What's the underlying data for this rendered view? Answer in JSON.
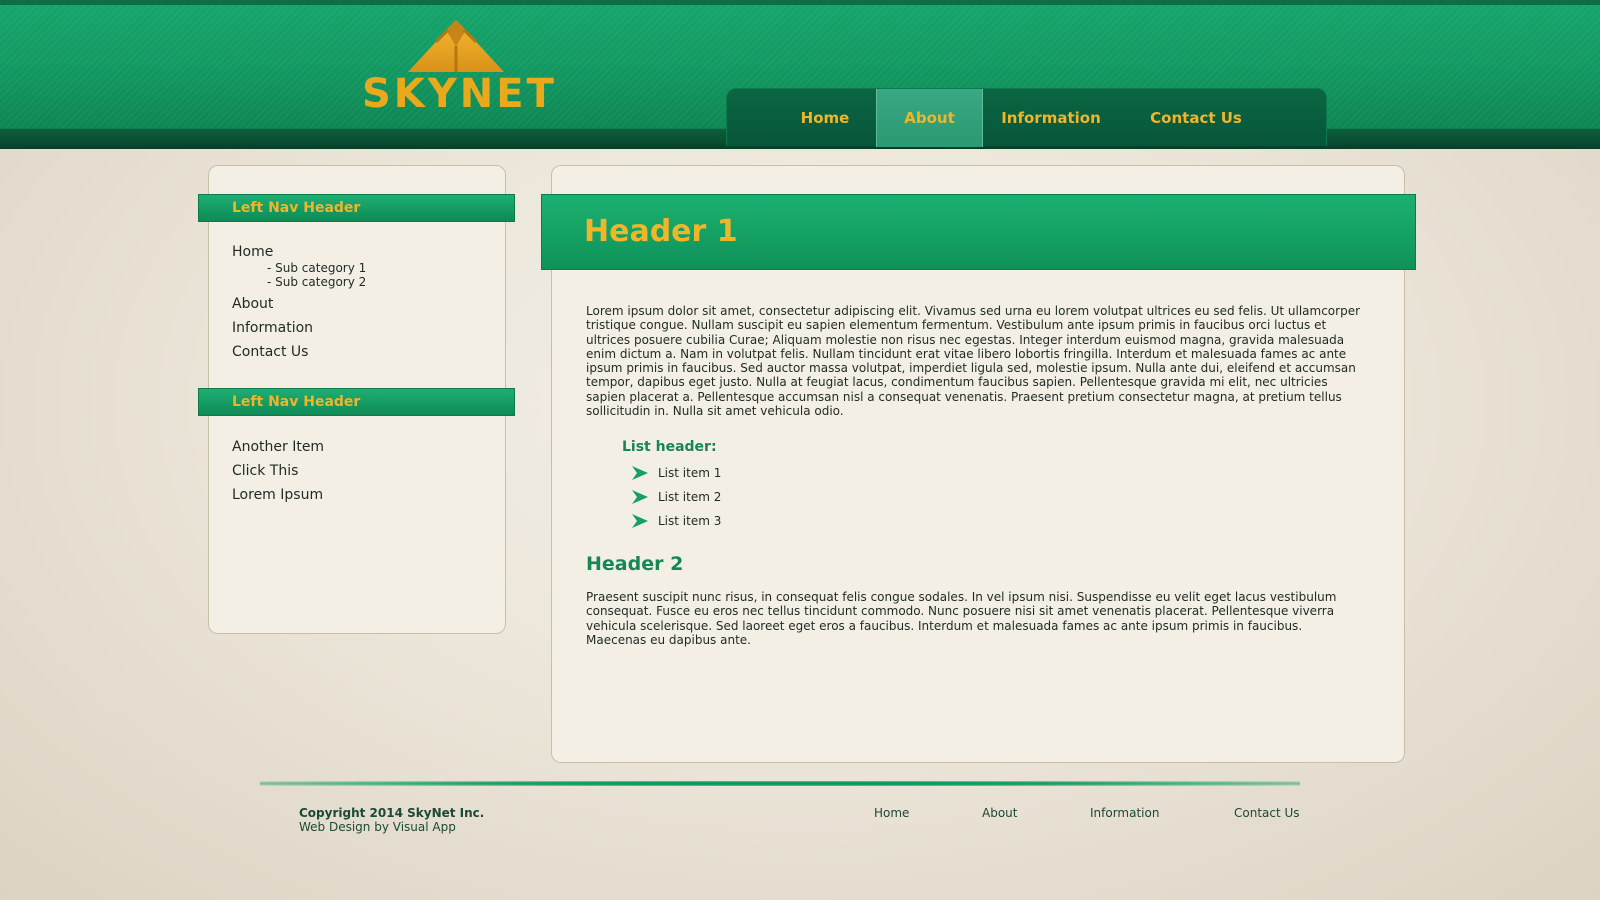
{
  "brand": {
    "name": "SKYNET",
    "colors": {
      "primary_green": "#149b63",
      "gold": "#f0b52a",
      "background": "#ece6da"
    }
  },
  "topnav": {
    "items": [
      {
        "label": "Home",
        "active": false
      },
      {
        "label": "About",
        "active": true
      },
      {
        "label": "Information",
        "active": false
      },
      {
        "label": "Contact Us",
        "active": false
      }
    ]
  },
  "sidebar": {
    "sections": [
      {
        "header": "Left Nav Header",
        "items": [
          {
            "label": "Home",
            "sub": [
              "- Sub category 1",
              "- Sub category 2"
            ]
          },
          {
            "label": "About"
          },
          {
            "label": "Information"
          },
          {
            "label": "Contact Us"
          }
        ]
      },
      {
        "header": "Left Nav Header",
        "items": [
          {
            "label": "Another Item"
          },
          {
            "label": "Click This"
          },
          {
            "label": "Lorem Ipsum"
          }
        ]
      }
    ]
  },
  "main": {
    "title": "Header 1",
    "paragraph1": "Lorem ipsum dolor sit amet, consectetur adipiscing elit. Vivamus sed urna eu lorem volutpat ultrices eu sed felis. Ut ullamcorper tristique congue. Nullam suscipit eu sapien elementum fermentum. Vestibulum ante ipsum primis in faucibus orci luctus et ultrices posuere cubilia Curae; Aliquam molestie non risus nec egestas. Integer interdum euismod magna, gravida malesuada enim dictum a. Nam in volutpat felis. Nullam tincidunt erat vitae libero lobortis fringilla. Interdum et malesuada fames ac ante ipsum primis in faucibus. Sed auctor massa volutpat, imperdiet ligula sed, molestie ipsum. Nulla ante dui, eleifend et accumsan tempor, dapibus eget justo. Nulla at feugiat lacus, condimentum faucibus sapien. Pellentesque gravida mi elit, nec ultricies sapien placerat a. Pellentesque accumsan nisl a consequat venenatis. Praesent pretium consectetur magna, at pretium tellus sollicitudin in. Nulla sit amet vehicula odio.",
    "list_header": "List header:",
    "list_items": [
      "List item 1",
      "List item 2",
      "List item 3"
    ],
    "header2": "Header 2",
    "paragraph2": "Praesent suscipit nunc risus, in consequat felis congue sodales. In vel ipsum nisi. Suspendisse eu velit eget lacus vestibulum consequat. Fusce eu eros nec tellus tincidunt commodo. Nunc posuere nisi sit amet venenatis placerat. Pellentesque viverra vehicula scelerisque. Sed laoreet eget eros a faucibus. Interdum et malesuada fames ac ante ipsum primis in faucibus. Maecenas eu dapibus ante."
  },
  "footer": {
    "copyright": "Copyright 2014 SkyNet Inc.",
    "credit": "Web Design by Visual App",
    "links": [
      "Home",
      "About",
      "Information",
      "Contact Us"
    ]
  },
  "icons": {
    "logo": "pyramid-logo-icon",
    "list_bullet": "chevron-arrow-right-icon"
  }
}
